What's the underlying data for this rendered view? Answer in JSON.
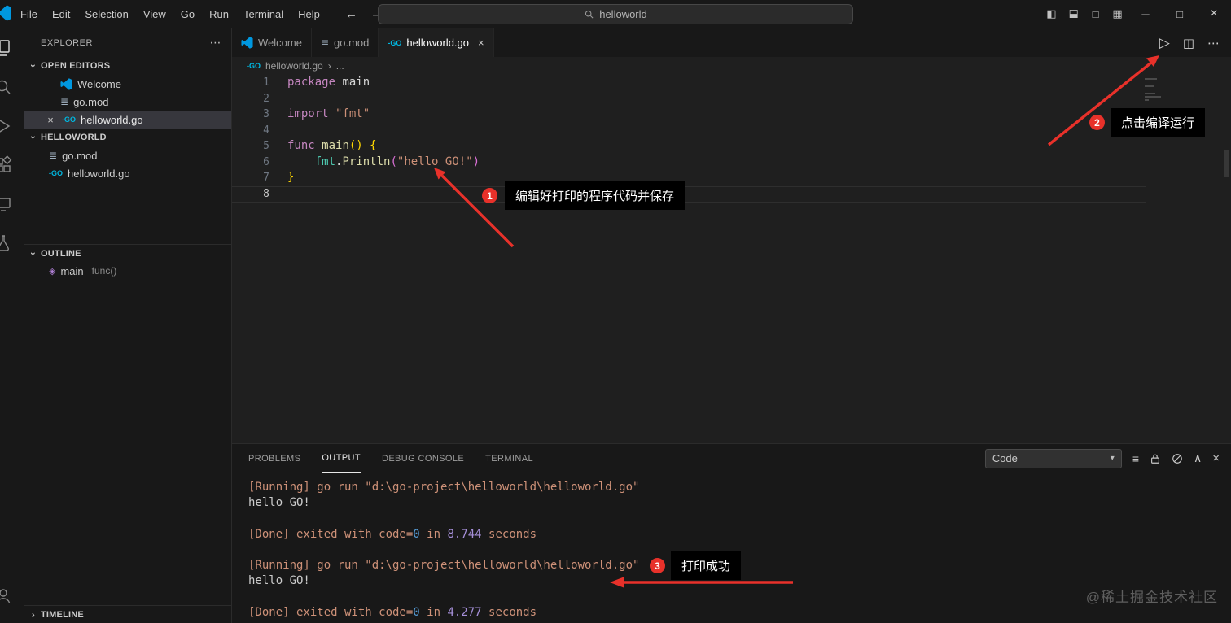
{
  "title_bar": {
    "menus": [
      "File",
      "Edit",
      "Selection",
      "View",
      "Go",
      "Run",
      "Terminal",
      "Help"
    ],
    "search_value": "helloworld",
    "window": {
      "minimize": "─",
      "maximize": "□",
      "close": "×"
    }
  },
  "icons": {
    "back": "←",
    "forward": "→",
    "more": "⋯",
    "chevron": "›",
    "go_badge": "-GO",
    "gomod": "≣",
    "run": "▷",
    "split_editor": "◫",
    "close": "×",
    "dropdown": "▾",
    "filter": "≡",
    "collapse": "∧",
    "layout_sidebar": "◧",
    "layout_panel": "◧",
    "layout_secondary": "□",
    "layout_customize": "▦",
    "outline_symbol": "◈"
  },
  "sidebar": {
    "title": "EXPLORER",
    "open_editors": {
      "label": "OPEN EDITORS",
      "items": [
        {
          "label": "Welcome"
        },
        {
          "label": "go.mod"
        },
        {
          "label": "helloworld.go"
        }
      ]
    },
    "project": {
      "label": "HELLOWORLD",
      "items": [
        {
          "label": "go.mod"
        },
        {
          "label": "helloworld.go"
        }
      ]
    },
    "outline": {
      "label": "OUTLINE",
      "items": [
        {
          "label": "main",
          "detail": "func()"
        }
      ]
    },
    "timeline": {
      "label": "TIMELINE"
    }
  },
  "editor": {
    "tabs": [
      {
        "label": "Welcome"
      },
      {
        "label": "go.mod"
      },
      {
        "label": "helloworld.go"
      }
    ],
    "breadcrumb": {
      "file": "helloworld.go",
      "more": "..."
    },
    "code_lines": [
      {
        "num": "1",
        "tokens": [
          {
            "t": "package",
            "c": "kw"
          },
          {
            "t": " "
          },
          {
            "t": "main"
          }
        ]
      },
      {
        "num": "2",
        "tokens": []
      },
      {
        "num": "3",
        "tokens": [
          {
            "t": "import",
            "c": "kw"
          },
          {
            "t": " "
          },
          {
            "t": "\"fmt\"",
            "c": "strlink"
          }
        ]
      },
      {
        "num": "4",
        "tokens": []
      },
      {
        "num": "5",
        "tokens": [
          {
            "t": "func",
            "c": "kw"
          },
          {
            "t": " "
          },
          {
            "t": "main",
            "c": "fn"
          },
          {
            "t": "()",
            "c": "b1"
          },
          {
            "t": " "
          },
          {
            "t": "{",
            "c": "b1"
          }
        ]
      },
      {
        "num": "6",
        "tokens": [
          {
            "t": "    "
          },
          {
            "t": "fmt",
            "c": "ns"
          },
          {
            "t": "."
          },
          {
            "t": "Println",
            "c": "fn"
          },
          {
            "t": "(",
            "c": "b2"
          },
          {
            "t": "\"hello GO!\"",
            "c": "str"
          },
          {
            "t": ")",
            "c": "b2"
          }
        ]
      },
      {
        "num": "7",
        "tokens": [
          {
            "t": "}",
            "c": "b1"
          }
        ]
      },
      {
        "num": "8",
        "tokens": []
      }
    ]
  },
  "panel": {
    "tabs": [
      {
        "label": "PROBLEMS"
      },
      {
        "label": "OUTPUT"
      },
      {
        "label": "DEBUG CONSOLE"
      },
      {
        "label": "TERMINAL"
      }
    ],
    "channel_selector": "Code",
    "output_lines": [
      {
        "tokens": [
          {
            "t": "[Running] go run \"d:\\go-project\\helloworld\\helloworld.go\"",
            "c": "orange"
          }
        ]
      },
      {
        "tokens": [
          {
            "t": "hello GO!",
            "c": "white"
          }
        ]
      },
      {
        "tokens": []
      },
      {
        "tokens": [
          {
            "t": "[Done] exited with code=",
            "c": "orange"
          },
          {
            "t": "0",
            "c": "blue"
          },
          {
            "t": " in ",
            "c": "orange"
          },
          {
            "t": "8.744",
            "c": "purple"
          },
          {
            "t": " seconds",
            "c": "orange"
          }
        ]
      },
      {
        "tokens": []
      },
      {
        "tokens": [
          {
            "t": "[Running] go run \"d:\\go-project\\helloworld\\helloworld.go\"",
            "c": "orange"
          }
        ]
      },
      {
        "tokens": [
          {
            "t": "hello GO!",
            "c": "white"
          }
        ]
      },
      {
        "tokens": []
      },
      {
        "tokens": [
          {
            "t": "[Done] exited with code=",
            "c": "orange"
          },
          {
            "t": "0",
            "c": "blue"
          },
          {
            "t": " in ",
            "c": "orange"
          },
          {
            "t": "4.277",
            "c": "purple"
          },
          {
            "t": " seconds",
            "c": "orange"
          }
        ]
      }
    ]
  },
  "annotations": {
    "step1": {
      "badge": "1",
      "label": "编辑好打印的程序代码并保存"
    },
    "step2": {
      "badge": "2",
      "label": "点击编译运行"
    },
    "step3": {
      "badge": "3",
      "label": "打印成功"
    }
  },
  "watermark": "@稀土掘金技术社区",
  "colors": {
    "annotation_red": "#e8312a",
    "accent_blue": "#0078d4"
  }
}
